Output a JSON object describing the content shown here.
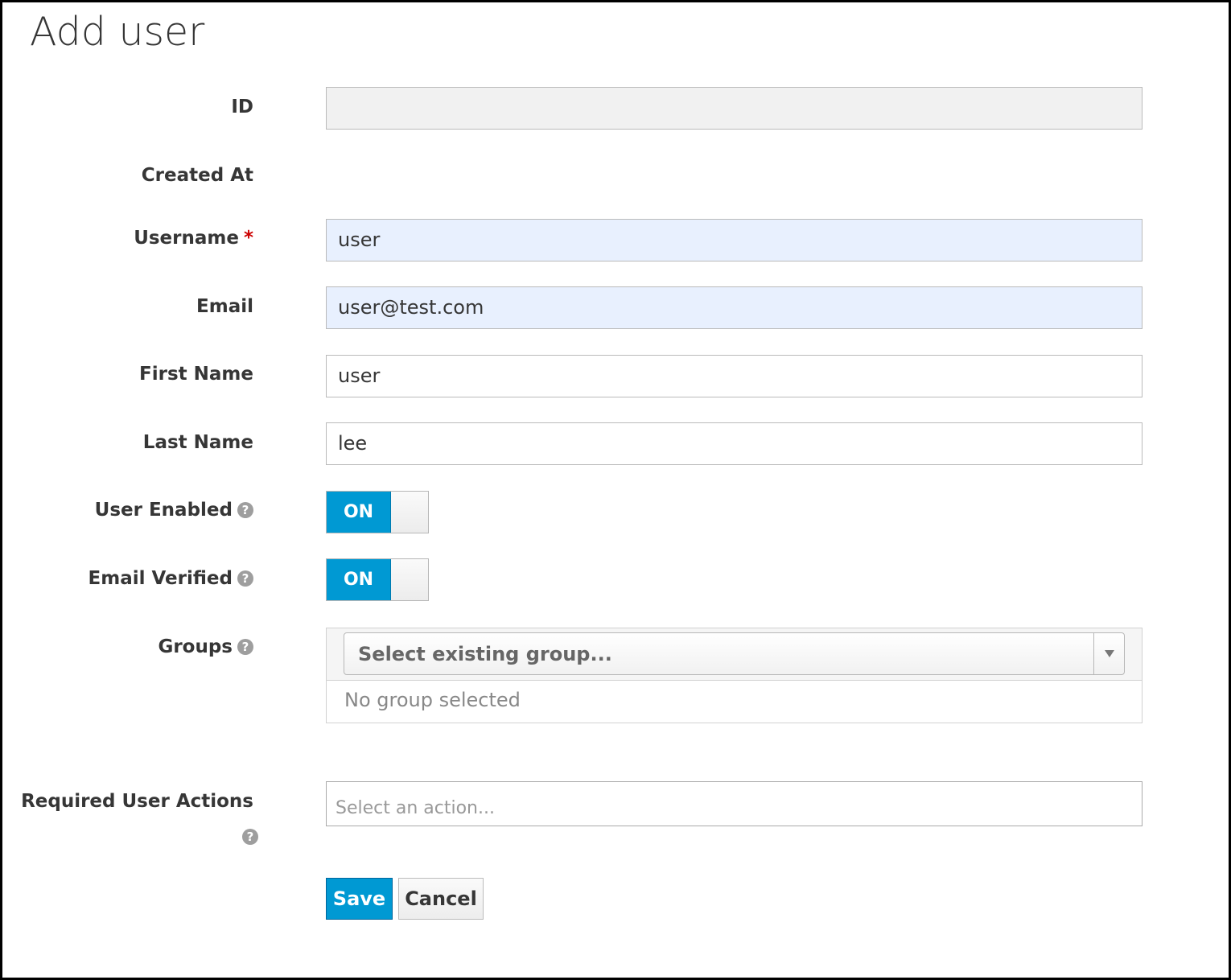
{
  "page": {
    "title": "Add user"
  },
  "form": {
    "id": {
      "label": "ID",
      "value": ""
    },
    "created_at": {
      "label": "Created At",
      "value": ""
    },
    "username": {
      "label": "Username",
      "required_mark": "*",
      "value": "user"
    },
    "email": {
      "label": "Email",
      "value": "user@test.com"
    },
    "first_name": {
      "label": "First Name",
      "value": "user"
    },
    "last_name": {
      "label": "Last Name",
      "value": "lee"
    },
    "user_enabled": {
      "label": "User Enabled",
      "state": "ON",
      "help_icon": "question-circle-icon"
    },
    "email_verified": {
      "label": "Email Verified",
      "state": "ON",
      "help_icon": "question-circle-icon"
    },
    "groups": {
      "label": "Groups",
      "select_placeholder": "Select existing group...",
      "empty_text": "No group selected",
      "help_icon": "question-circle-icon"
    },
    "required_actions": {
      "label": "Required User Actions",
      "placeholder": "Select an action...",
      "help_icon": "question-circle-icon"
    }
  },
  "buttons": {
    "save": "Save",
    "cancel": "Cancel"
  },
  "colors": {
    "accent": "#0099d3",
    "required": "#cc0000",
    "autofill_bg": "#e8f0fe",
    "readonly_bg": "#f1f1f1"
  }
}
